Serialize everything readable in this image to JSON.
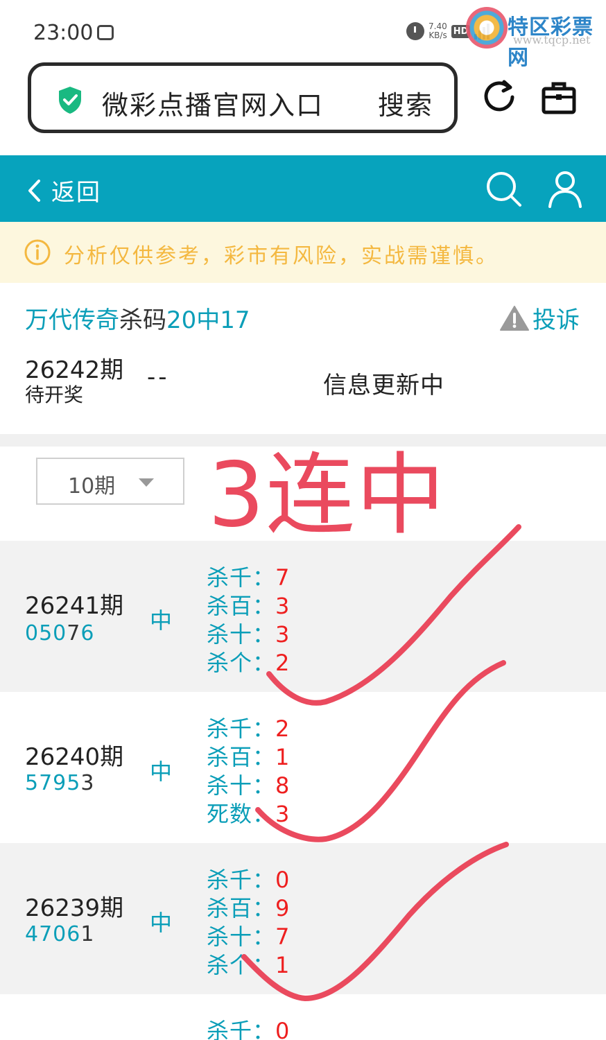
{
  "status_bar": {
    "time": "23:00",
    "net_speed_value": "7.40",
    "net_speed_unit": "KB/s",
    "hd_badge": "HD",
    "watermark_text": "特区彩票网",
    "watermark_url": "www.tqcp.net"
  },
  "address_bar": {
    "title": "微彩点播官网入口",
    "search_label": "搜索"
  },
  "header": {
    "back_label": "返回"
  },
  "notice": {
    "text": "分析仅供参考，彩市有风险，实战需谨慎。"
  },
  "plan": {
    "expert_name": "万代传奇",
    "plan_type": "杀码",
    "hit_stat": "20中17",
    "complaint_label": "投诉"
  },
  "current_draw": {
    "period": "26242期",
    "status": "待开奖",
    "numbers": "--",
    "info": "信息更新中"
  },
  "filter": {
    "selected_range": "10期"
  },
  "annotation": {
    "handwritten_text": "3连中"
  },
  "records": [
    {
      "period": "26241期",
      "number_teal": "050",
      "number_dark": "7",
      "number_teal_end": "6",
      "result": "中",
      "kills": [
        {
          "label": "杀千：",
          "value": "7"
        },
        {
          "label": "杀百：",
          "value": "3"
        },
        {
          "label": "杀十：",
          "value": "3"
        },
        {
          "label": "杀个：",
          "value": "2"
        }
      ]
    },
    {
      "period": "26240期",
      "number_teal": "5795",
      "number_dark": "3",
      "number_teal_end": "",
      "result": "中",
      "kills": [
        {
          "label": "杀千：",
          "value": "2"
        },
        {
          "label": "杀百：",
          "value": "1"
        },
        {
          "label": "杀十：",
          "value": "8"
        },
        {
          "label": "死数：",
          "value": "3"
        }
      ]
    },
    {
      "period": "26239期",
      "number_teal": "4706",
      "number_dark": "1",
      "number_teal_end": "",
      "result": "中",
      "kills": [
        {
          "label": "杀千：",
          "value": "0"
        },
        {
          "label": "杀百：",
          "value": "9"
        },
        {
          "label": "杀十：",
          "value": "7"
        },
        {
          "label": "杀个：",
          "value": "1"
        }
      ]
    },
    {
      "kills": [
        {
          "label": "杀千：",
          "value": "0"
        }
      ]
    }
  ],
  "colors": {
    "teal_header": "#07a3bd",
    "teal_text": "#0b9eb8",
    "kill_value_red": "#ee1f1f",
    "annotation_red": "#ea4a5e",
    "notice_bg": "#fdf7de",
    "notice_text": "#f4b840",
    "row_alt_bg": "#f2f2f2"
  }
}
